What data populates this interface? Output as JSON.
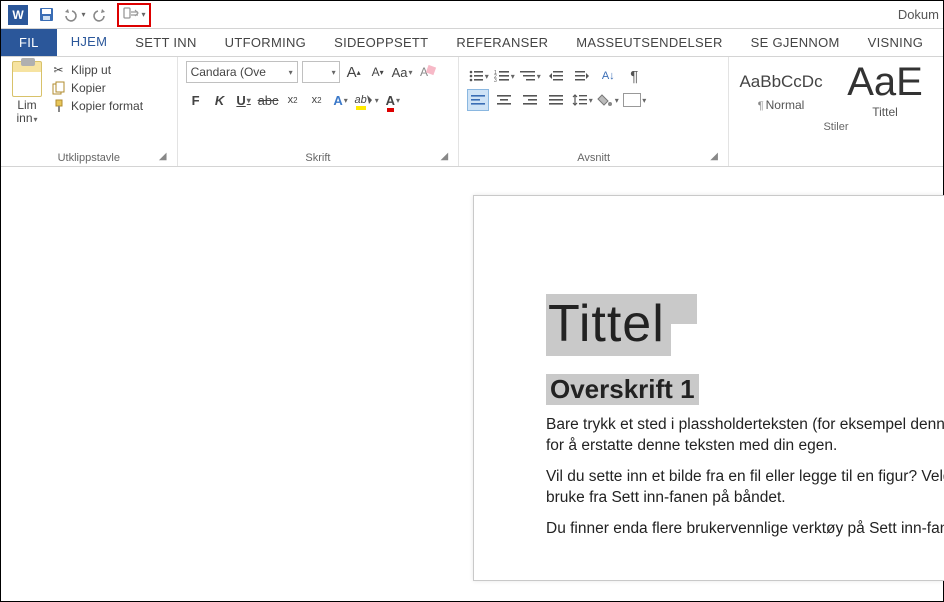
{
  "window": {
    "doc_name": "Dokum"
  },
  "tabs": {
    "fil": "FIL",
    "items": [
      "HJEM",
      "SETT INN",
      "UTFORMING",
      "SIDEOPPSETT",
      "REFERANSER",
      "MASSEUTSENDELSER",
      "SE GJENNOM",
      "VISNING"
    ],
    "active_index": 0
  },
  "ribbon": {
    "clipboard": {
      "label": "Utklippstavle",
      "paste": "Lim inn",
      "cut": "Klipp ut",
      "copy": "Kopier",
      "format_painter": "Kopier format"
    },
    "font": {
      "label": "Skrift",
      "family": "Candara (Ove",
      "size": "",
      "grow": "A",
      "shrink": "A",
      "case": "Aa",
      "clear": "A",
      "bold": "F",
      "italic": "K",
      "underline": "U",
      "strike": "abc",
      "sub": "x",
      "sup": "x",
      "text_effect": "A",
      "highlight": "ab",
      "font_color": "A"
    },
    "paragraph": {
      "label": "Avsnitt"
    },
    "styles": {
      "label": "Stiler",
      "normal_preview": "AaBbCcDc",
      "normal_name": "Normal",
      "title_preview": "AaE",
      "title_name": "Tittel"
    }
  },
  "document": {
    "title": "Tittel",
    "heading1": "Overskrift 1",
    "p1": "Bare trykk et sted i plassholderteksten (for eksempel denne) og begynn å skrive for å erstatte denne teksten med din egen.",
    "p2": "Vil du sette inn et bilde fra en fil eller legge til en figur? Velg alternativet du vil bruke fra Sett inn-fanen på båndet.",
    "p3": "Du finner enda flere brukervennlige verktøy på Sett inn-fanen,"
  }
}
